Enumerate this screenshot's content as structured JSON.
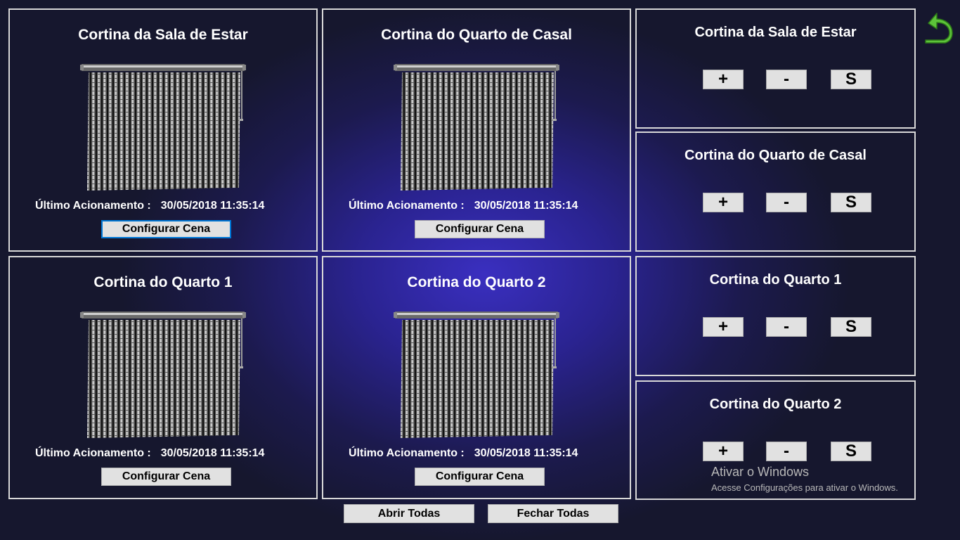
{
  "curtain_panels": [
    {
      "title": "Cortina da Sala de Estar",
      "last_label": "Último Acionamento :",
      "last_value": "30/05/2018 11:35:14",
      "config_label": "Configurar Cena"
    },
    {
      "title": "Cortina do Quarto de Casal",
      "last_label": "Último Acionamento :",
      "last_value": "30/05/2018 11:35:14",
      "config_label": "Configurar Cena"
    },
    {
      "title": "Cortina do Quarto 1",
      "last_label": "Último Acionamento :",
      "last_value": "30/05/2018 11:35:14",
      "config_label": "Configurar Cena"
    },
    {
      "title": "Cortina do Quarto 2",
      "last_label": "Último Acionamento :",
      "last_value": "30/05/2018 11:35:14",
      "config_label": "Configurar Cena"
    }
  ],
  "control_panels": [
    {
      "title": "Cortina da Sala de Estar",
      "plus": "+",
      "minus": "-",
      "stop": "S"
    },
    {
      "title": "Cortina do Quarto de Casal",
      "plus": "+",
      "minus": "-",
      "stop": "S"
    },
    {
      "title": "Cortina do Quarto 1",
      "plus": "+",
      "minus": "-",
      "stop": "S"
    },
    {
      "title": "Cortina do Quarto 2",
      "plus": "+",
      "minus": "-",
      "stop": "S"
    }
  ],
  "bottom": {
    "open_all": "Abrir Todas",
    "close_all": "Fechar Todas"
  },
  "watermark": {
    "title": "Ativar o Windows",
    "subtitle": "Acesse Configurações para ativar o Windows."
  },
  "icons": {
    "back": "back-arrow-icon"
  },
  "colors": {
    "accent_green": "#5cc23a",
    "focus_blue": "#0078d7",
    "background": "#1c1a4e"
  }
}
